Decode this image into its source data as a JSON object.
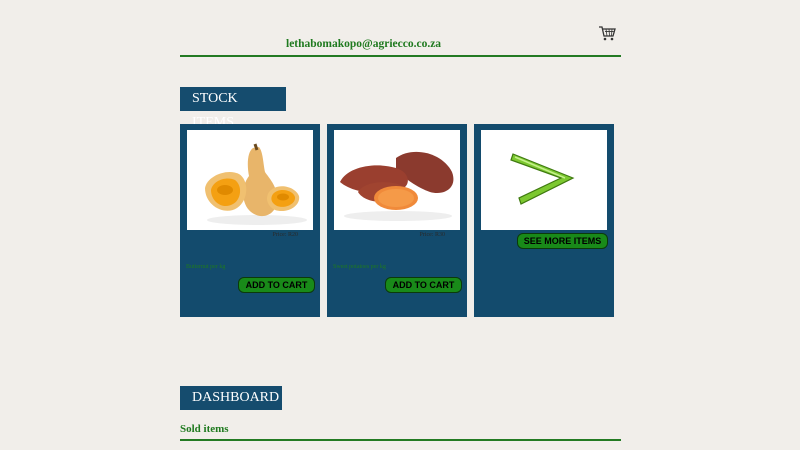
{
  "header": {
    "email": "lethabomakopo@agriecco.co.za",
    "cart_icon": "shopping-cart-icon"
  },
  "stock": {
    "title": "STOCK ITEMS",
    "items": [
      {
        "image": "butternut-squash",
        "price": "Price: R20",
        "description": "Butternut per kg",
        "add_label": "ADD TO CART"
      },
      {
        "image": "sweet-potatoes",
        "price": "Price: R30",
        "description": "Sweet potatoes per kg",
        "add_label": "ADD TO CART"
      }
    ],
    "more": {
      "image": "green-arrow-right",
      "label": "SEE MORE ITEMS"
    }
  },
  "dashboard": {
    "title": "DASHBOARD",
    "sold_label": "Sold items"
  },
  "colors": {
    "background": "#f1eeea",
    "navy": "#134b6d",
    "green_text": "#1f7a1f",
    "button_green": "#198a19"
  }
}
